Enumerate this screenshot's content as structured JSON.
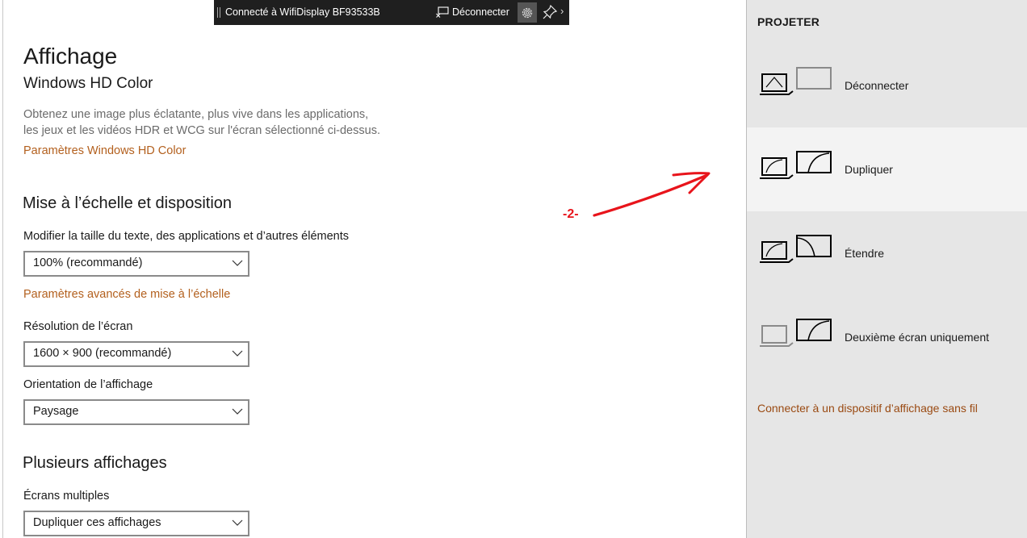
{
  "connection_bar": {
    "status": "Connecté à WifiDisplay BF93533B",
    "disconnect_label": "Déconnecter"
  },
  "settings": {
    "title": "Affichage",
    "hd_color": {
      "heading": "Windows HD Color",
      "description_line1": "Obtenez une image plus éclatante, plus vive dans les applications,",
      "description_line2": "les jeux et les vidéos HDR et WCG sur l'écran sélectionné ci-dessus.",
      "link": "Paramètres Windows HD Color"
    },
    "scale": {
      "heading": "Mise à l’échelle et disposition",
      "text_size_label": "Modifier la taille du texte, des applications et d’autres éléments",
      "text_size_value": "100% (recommandé)",
      "advanced_link": "Paramètres avancés de mise à l’échelle",
      "resolution_label": "Résolution de l’écran",
      "resolution_value": "1600 × 900 (recommandé)",
      "orientation_label": "Orientation de l’affichage",
      "orientation_value": "Paysage"
    },
    "multi": {
      "heading": "Plusieurs affichages",
      "label": "Écrans multiples",
      "value": "Dupliquer ces affichages"
    }
  },
  "annotation": {
    "label": "-2-",
    "color": "#e8141b"
  },
  "project_panel": {
    "title": "PROJETER",
    "options": [
      {
        "label": "Déconnecter",
        "icon": "pc-screen-only-icon",
        "selected": false
      },
      {
        "label": "Dupliquer",
        "icon": "duplicate-icon",
        "selected": true
      },
      {
        "label": "Étendre",
        "icon": "extend-icon",
        "selected": false
      },
      {
        "label": "Deuxième écran uniquement",
        "icon": "second-screen-only-icon",
        "selected": false
      }
    ],
    "wireless_link": "Connecter à un dispositif d’affichage sans fil"
  },
  "colors": {
    "accent_link": "#b3601e",
    "panel_bg": "#e6e6e6",
    "selected_bg": "#f3f3f3",
    "connection_bar_bg": "#1f1f1f"
  }
}
